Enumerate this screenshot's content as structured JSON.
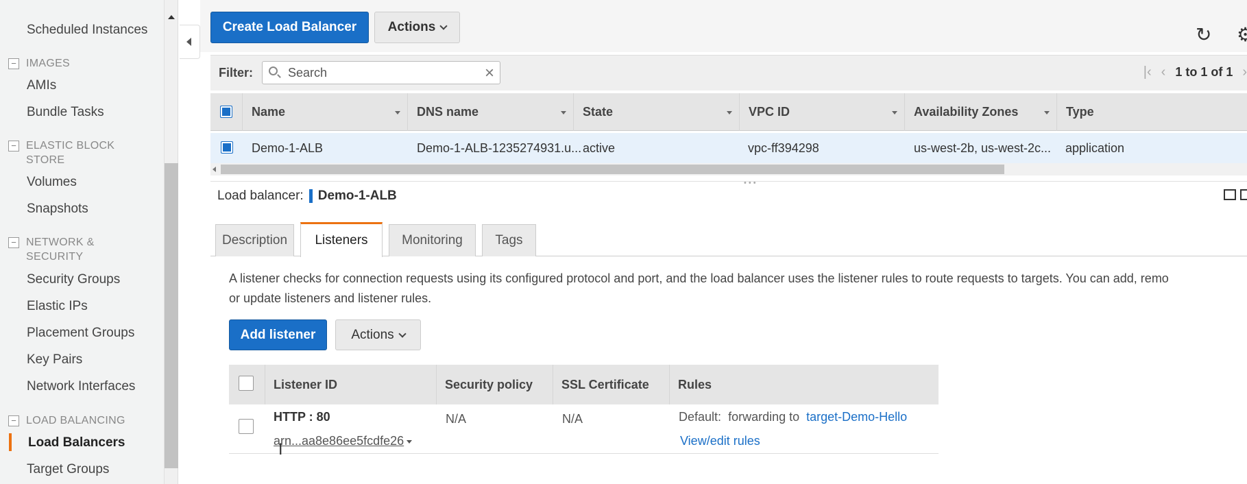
{
  "sidebar": {
    "top_item": "Scheduled Instances",
    "sections": [
      {
        "title": "IMAGES",
        "items": [
          "AMIs",
          "Bundle Tasks"
        ]
      },
      {
        "title_line1": "ELASTIC BLOCK",
        "title_line2": "STORE",
        "items": [
          "Volumes",
          "Snapshots"
        ]
      },
      {
        "title_line1": "NETWORK &",
        "title_line2": "SECURITY",
        "items": [
          "Security Groups",
          "Elastic IPs",
          "Placement Groups",
          "Key Pairs",
          "Network Interfaces"
        ]
      },
      {
        "title": "LOAD BALANCING",
        "items": [
          "Load Balancers",
          "Target Groups"
        ]
      }
    ],
    "active_item": "Load Balancers"
  },
  "toolbar": {
    "create_label": "Create Load Balancer",
    "actions_label": "Actions"
  },
  "filter": {
    "label": "Filter:",
    "placeholder": "Search",
    "pager_text": "1 to 1 of 1"
  },
  "table": {
    "columns": [
      "Name",
      "DNS name",
      "State",
      "VPC ID",
      "Availability Zones",
      "Type"
    ],
    "rows": [
      {
        "name": "Demo-1-ALB",
        "dns": "Demo-1-ALB-1235274931.u...",
        "state": "active",
        "vpc": "vpc-ff394298",
        "zones": "us-west-2b, us-west-2c...",
        "type": "application"
      }
    ]
  },
  "detail": {
    "label": "Load balancer:",
    "name": "Demo-1-ALB",
    "tabs": [
      "Description",
      "Listeners",
      "Monitoring",
      "Tags"
    ],
    "active_tab": "Listeners",
    "description_line1": "A listener checks for connection requests using its configured protocol and port, and the load balancer uses the listener rules to route requests to targets. You can add, remo",
    "description_line2": "or update listeners and listener rules.",
    "add_listener_label": "Add listener",
    "actions_label": "Actions"
  },
  "listeners": {
    "columns": [
      "Listener ID",
      "Security policy",
      "SSL Certificate",
      "Rules"
    ],
    "rows": [
      {
        "id": "HTTP : 80",
        "arn": "arn...aa8e86ee5fcdfe26",
        "security_policy": "N/A",
        "ssl_certificate": "N/A",
        "rule_prefix": "Default:",
        "rule_action": "forwarding to",
        "rule_target": "target-Demo-Hello",
        "edit_link": "View/edit rules"
      }
    ]
  },
  "colors": {
    "accent": "#ec7211",
    "primary": "#1a6fc7"
  }
}
